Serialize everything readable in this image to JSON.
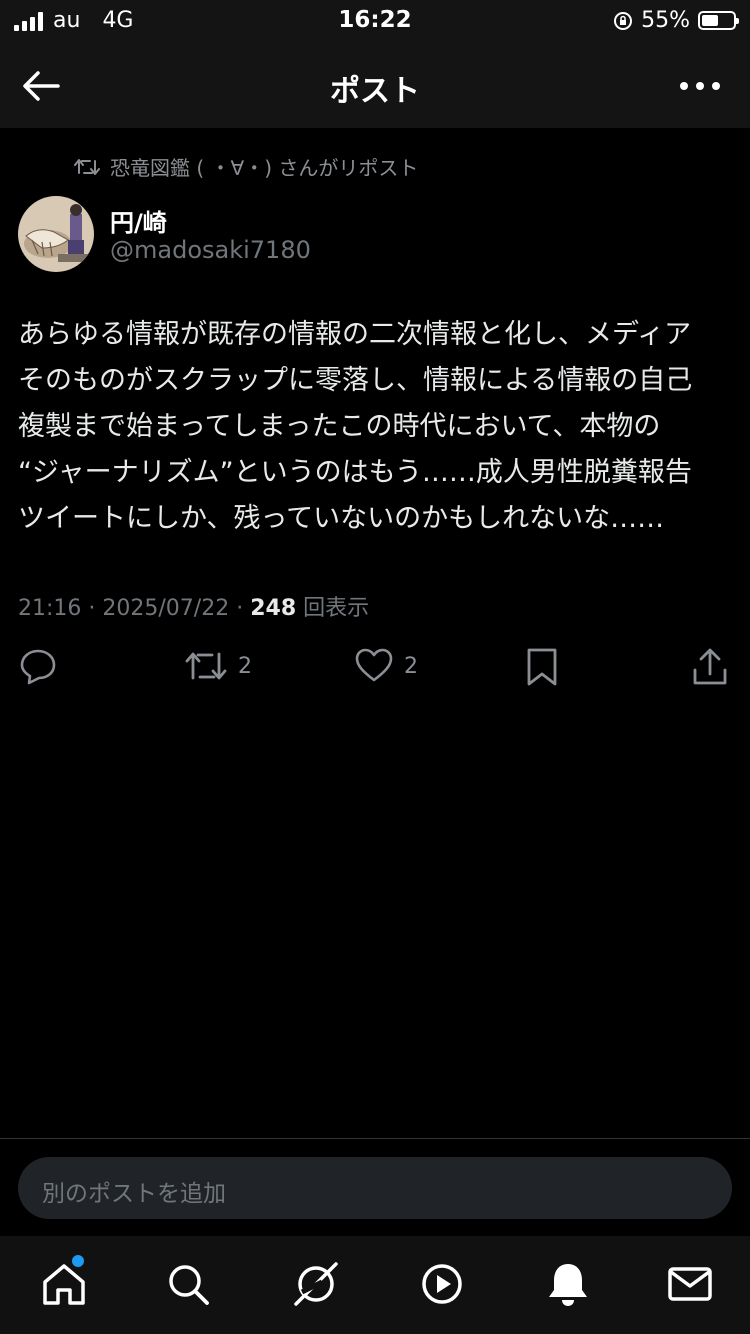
{
  "status_bar": {
    "carrier": "au",
    "network": "4G",
    "time": "16:22",
    "battery": "55%"
  },
  "header": {
    "title": "ポスト"
  },
  "post": {
    "reposted_by": "恐竜図鑑 (  ・∀・) さんがリポスト",
    "author_name": "円/崎",
    "author_handle": "@madosaki7180",
    "lines": [
      "あらゆる情報が既存の情報の二次情報と化し、メディア",
      "そのものがスクラップに零落し、情報による情報の自己",
      "複製まで始まってしまったこの時代において、本物の",
      "“ジャーナリズム”というのはもう……成人男性脱糞報告",
      "ツイートにしか、残っていないのかもしれないな……"
    ],
    "time": "21:16",
    "date": "2025/07/22",
    "views_count": "248",
    "views_label": "回表示",
    "retweets": "2",
    "likes": "2"
  },
  "composer": {
    "placeholder": "別のポストを追加"
  },
  "colors": {
    "background": "#000000",
    "secondary_text": "#71767b",
    "accent": "#1d9bf0"
  },
  "icons": [
    "back-arrow-icon",
    "more-icon",
    "retweet-icon",
    "reply-icon",
    "like-icon",
    "bookmark-icon",
    "share-icon",
    "home-icon",
    "search-icon",
    "grok-icon",
    "play-icon",
    "notifications-icon",
    "messages-icon"
  ]
}
